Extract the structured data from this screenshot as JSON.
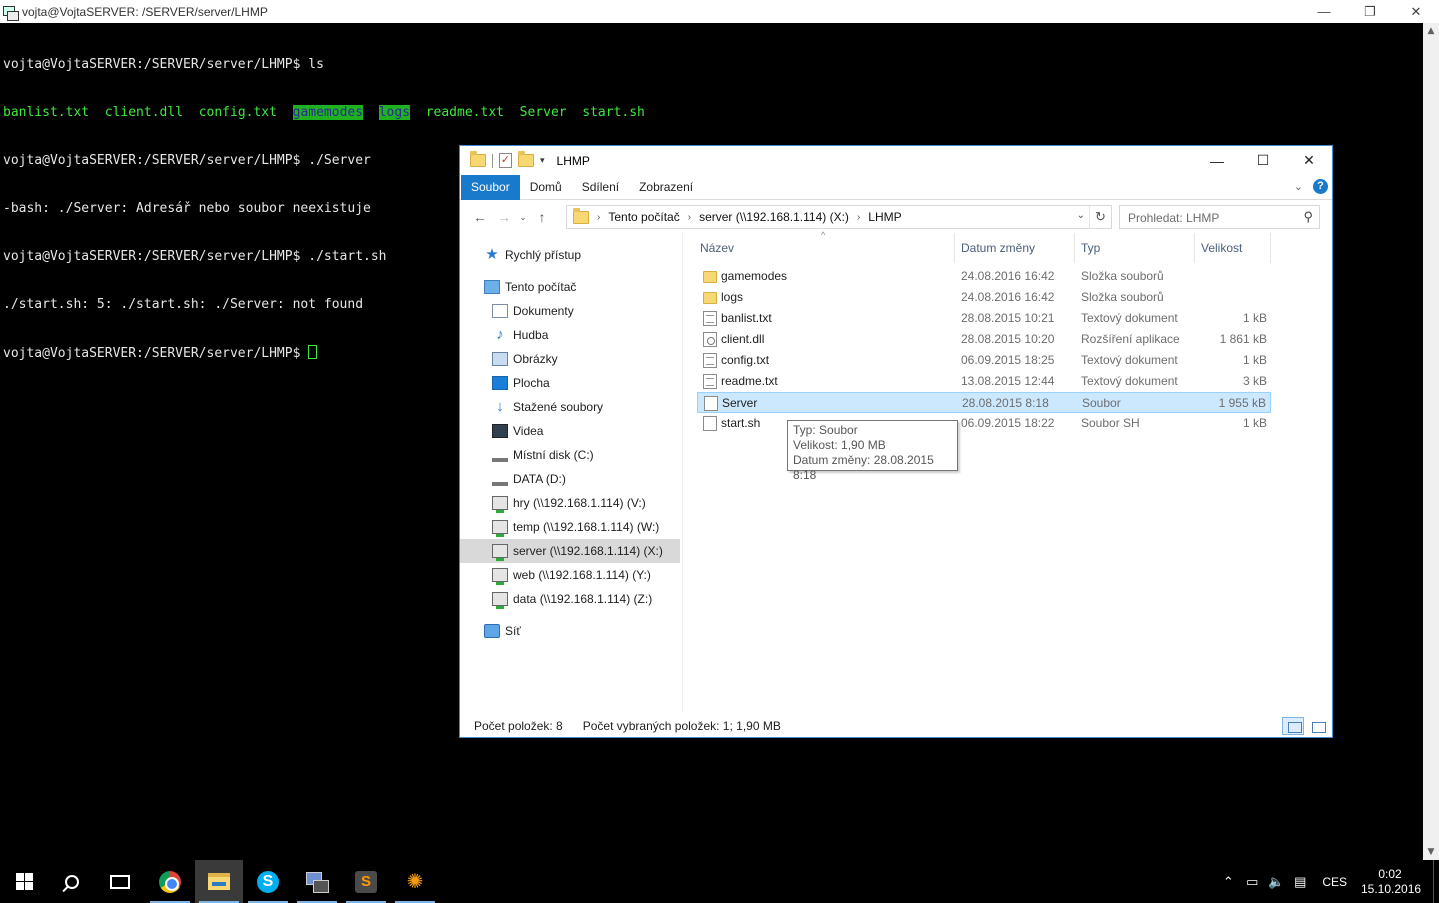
{
  "putty": {
    "title": "vojta@VojtaSERVER: /SERVER/server/LHMP",
    "controls": {
      "minimize": "—",
      "restore": "❐",
      "close": "✕"
    }
  },
  "terminal": {
    "prompt1": "vojta@VojtaSERVER:/SERVER/server/LHMP$ ls",
    "ls_items": [
      "banlist.txt",
      "client.dll",
      "config.txt",
      "gamemodes",
      "logs",
      "readme.txt",
      "Server",
      "start.sh"
    ],
    "prompt2": "vojta@VojtaSERVER:/SERVER/server/LHMP$ ./Server",
    "error1": "-bash: ./Server: Adresář nebo soubor neexistuje",
    "prompt3": "vojta@VojtaSERVER:/SERVER/server/LHMP$ ./start.sh",
    "error2": "./start.sh: 5: ./start.sh: ./Server: not found",
    "prompt4": "vojta@VojtaSERVER:/SERVER/server/LHMP$ "
  },
  "explorer": {
    "title": "LHMP",
    "ribbon_tabs": [
      "Soubor",
      "Domů",
      "Sdílení",
      "Zobrazení"
    ],
    "help": "?",
    "breadcrumb": [
      "Tento počítač",
      "server (\\\\192.168.1.114) (X:)",
      "LHMP"
    ],
    "search_placeholder": "Prohledat: LHMP",
    "nav": [
      {
        "label": "Rychlý přístup"
      },
      {
        "label": "Tento počítač"
      },
      {
        "label": "Dokumenty"
      },
      {
        "label": "Hudba"
      },
      {
        "label": "Obrázky"
      },
      {
        "label": "Plocha"
      },
      {
        "label": "Stažené soubory"
      },
      {
        "label": "Videa"
      },
      {
        "label": "Místní disk (C:)"
      },
      {
        "label": "DATA (D:)"
      },
      {
        "label": "hry (\\\\192.168.1.114) (V:)"
      },
      {
        "label": "temp (\\\\192.168.1.114) (W:)"
      },
      {
        "label": "server (\\\\192.168.1.114) (X:)"
      },
      {
        "label": "web (\\\\192.168.1.114) (Y:)"
      },
      {
        "label": "data (\\\\192.168.1.114) (Z:)"
      },
      {
        "label": "Síť"
      }
    ],
    "columns": {
      "name": "Název",
      "date": "Datum změny",
      "type": "Typ",
      "size": "Velikost"
    },
    "files": [
      {
        "name": "gamemodes",
        "date": "24.08.2016 16:42",
        "type": "Složka souborů",
        "size": ""
      },
      {
        "name": "logs",
        "date": "24.08.2016 16:42",
        "type": "Složka souborů",
        "size": ""
      },
      {
        "name": "banlist.txt",
        "date": "28.08.2015 10:21",
        "type": "Textový dokument",
        "size": "1 kB"
      },
      {
        "name": "client.dll",
        "date": "28.08.2015 10:20",
        "type": "Rozšíření aplikace",
        "size": "1 861 kB"
      },
      {
        "name": "config.txt",
        "date": "06.09.2015 18:25",
        "type": "Textový dokument",
        "size": "1 kB"
      },
      {
        "name": "readme.txt",
        "date": "13.08.2015 12:44",
        "type": "Textový dokument",
        "size": "3 kB"
      },
      {
        "name": "Server",
        "date": "28.08.2015 8:18",
        "type": "Soubor",
        "size": "1 955 kB"
      },
      {
        "name": "start.sh",
        "date": "06.09.2015 18:22",
        "type": "Soubor SH",
        "size": "1 kB"
      }
    ],
    "tooltip": {
      "type": "Typ: Soubor",
      "size": "Velikost: 1,90 MB",
      "date": "Datum změny: 28.08.2015 8:18"
    },
    "status": {
      "count": "Počet položek: 8",
      "selected": "Počet vybraných položek: 1; 1,90 MB"
    }
  },
  "taskbar": {
    "language": "CES",
    "time": "0:02",
    "date": "15.10.2016"
  },
  "colors": {
    "terminal_green": "#3fe83f",
    "dir_highlight": "#1fb21f",
    "accent": "#1979ca",
    "selection": "#cce8ff"
  }
}
